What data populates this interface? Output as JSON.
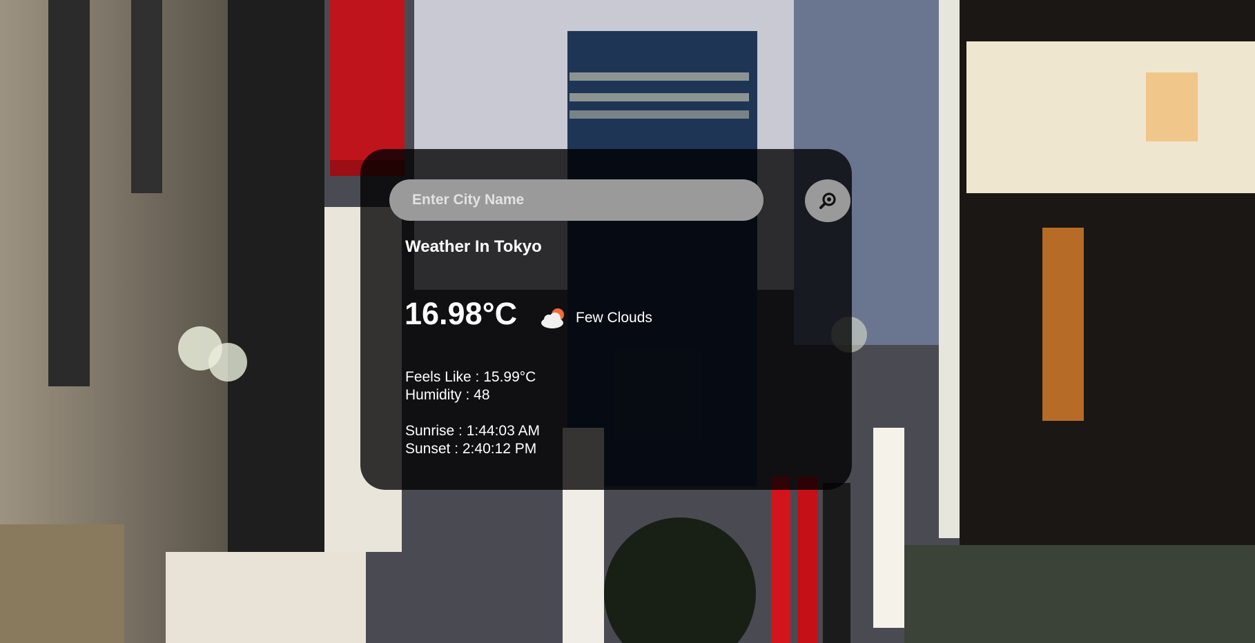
{
  "search": {
    "placeholder": "Enter City Name",
    "value": ""
  },
  "weather": {
    "title": "Weather In Tokyo",
    "temperature": "16.98°C",
    "condition": "Few Clouds",
    "condition_icon": "few-clouds-icon",
    "feels_like": "Feels Like : 15.99°C",
    "humidity": "Humidity : 48",
    "sunrise": "Sunrise : 1:44:03 AM",
    "sunset": "Sunset : 2:40:12 PM"
  },
  "colors": {
    "card_background": "#000000c7",
    "input_background": "#9a9a9a",
    "text": "#ffffff",
    "sun": "#f26b3a",
    "cloud": "#f0f0f0"
  }
}
